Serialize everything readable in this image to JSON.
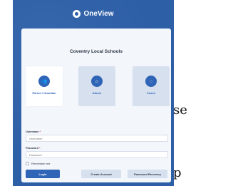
{
  "app": {
    "name": "OneView"
  },
  "login": {
    "school_name": "Coventry Local Schools",
    "roles": [
      {
        "label": "Parent / Guardian",
        "icon": "people-icon",
        "selected": true
      },
      {
        "label": "Admin",
        "icon": "building-icon",
        "selected": false
      },
      {
        "label": "Coach",
        "icon": "ball-icon",
        "selected": false
      }
    ],
    "username": {
      "label": "Username",
      "required_mark": "*",
      "placeholder": "Username",
      "value": ""
    },
    "password": {
      "label": "Password",
      "required_mark": "*",
      "placeholder": "Password",
      "value": ""
    },
    "remember_me_label": "Remember me",
    "buttons": {
      "login": "Login",
      "create_account": "Create Account",
      "password_recovery": "Password Recovery"
    }
  },
  "background_text": {
    "t1": "se",
    "t2": "",
    "t3": "p"
  },
  "colors": {
    "header_bg": "#2d5fa7",
    "primary": "#2f64b6",
    "tile_bg": "#d7e0ee",
    "card_bg": "#f3f6fb"
  }
}
